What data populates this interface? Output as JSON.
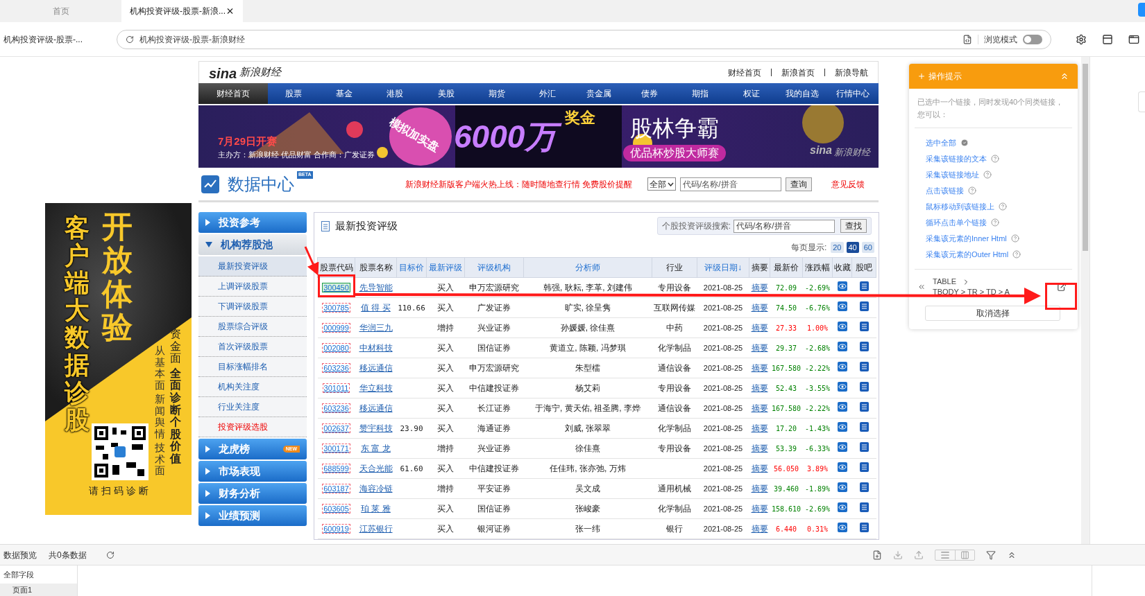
{
  "browser": {
    "tabs": [
      {
        "label": "首页",
        "selected": false
      },
      {
        "label": "机构投资评级-股票-新浪...",
        "selected": true
      }
    ],
    "page_title": "机构投资评级-股票-...",
    "address": "机构投资评级-股票-新浪财经",
    "browse_mode": {
      "label": "浏览模式",
      "on": false
    }
  },
  "site": {
    "logo_mark": "sina",
    "logo": "新浪财经",
    "top_links": [
      "财经首页",
      "新浪首页",
      "新浪导航"
    ],
    "nav": [
      {
        "label": "财经首页",
        "selected": true
      },
      {
        "label": "股票",
        "selected": false
      },
      {
        "label": "基金",
        "selected": false
      },
      {
        "label": "港股",
        "selected": false
      },
      {
        "label": "美股",
        "selected": false
      },
      {
        "label": "期货",
        "selected": false
      },
      {
        "label": "外汇",
        "selected": false
      },
      {
        "label": "贵金属",
        "selected": false
      },
      {
        "label": "债券",
        "selected": false
      },
      {
        "label": "期指",
        "selected": false
      },
      {
        "label": "权证",
        "selected": false
      },
      {
        "label": "我的自选",
        "selected": false
      },
      {
        "label": "行情中心",
        "selected": false
      }
    ],
    "banner": {
      "date": "7月29日开赛",
      "sponsors": "主办方：新浪财经 优品财富 合作商：广发证券",
      "tag": "模拟加实盘",
      "amount": "6000万",
      "prize": "奖金",
      "headline": "股林争霸",
      "subtitle": "优品杯炒股大师赛",
      "brand_mark": "sina",
      "brand": "新浪财经"
    },
    "data_center": {
      "title": "数据中心",
      "badge": "BETA",
      "promo": "新浪财经新版客户端火热上线：随时随地查行情 免费股价提醒",
      "scope": "全部",
      "search_placeholder": "代码/名称/拼音",
      "search_button": "查询",
      "feedback": "意见反馈"
    }
  },
  "ad": {
    "headline": "开放体验",
    "title": "客户端大数据诊股",
    "line_1": "资金面",
    "line_2": "全面诊断个股价值",
    "line_3": [
      "从基本面",
      "新闻舆情",
      "技术面"
    ],
    "caption": "请扫码诊断"
  },
  "sidebar": {
    "sections": [
      {
        "label": "投资参考",
        "expanded": false
      },
      {
        "label": "机构荐股池",
        "expanded": true,
        "items": [
          {
            "label": "最新投资评级",
            "selected": true,
            "emphasized": false
          },
          {
            "label": "上调评级股票",
            "selected": false,
            "emphasized": false
          },
          {
            "label": "下调评级股票",
            "selected": false,
            "emphasized": false
          },
          {
            "label": "股票综合评级",
            "selected": false,
            "emphasized": false
          },
          {
            "label": "首次评级股票",
            "selected": false,
            "emphasized": false
          },
          {
            "label": "目标涨幅排名",
            "selected": false,
            "emphasized": false
          },
          {
            "label": "机构关注度",
            "selected": false,
            "emphasized": false
          },
          {
            "label": "行业关注度",
            "selected": false,
            "emphasized": false
          },
          {
            "label": "投资评级选股",
            "selected": false,
            "emphasized": true
          }
        ]
      },
      {
        "label": "龙虎榜",
        "expanded": false,
        "badge": "NEW"
      },
      {
        "label": "市场表现",
        "expanded": false
      },
      {
        "label": "财务分析",
        "expanded": false
      },
      {
        "label": "业绩预测",
        "expanded": false
      }
    ]
  },
  "ratings": {
    "title": "最新投资评级",
    "search_label": "个股投资评级搜索:",
    "search_placeholder": "代码/名称/拼音",
    "search_button": "查找",
    "page_size_label": "每页显示:",
    "page_sizes": [
      {
        "label": "20",
        "selected": false
      },
      {
        "label": "40",
        "selected": true
      },
      {
        "label": "60",
        "selected": false
      }
    ],
    "columns": [
      {
        "label": "股票代码",
        "link": false
      },
      {
        "label": "股票名称",
        "link": false
      },
      {
        "label": "目标价",
        "link": true
      },
      {
        "label": "最新评级",
        "link": true
      },
      {
        "label": "评级机构",
        "link": true
      },
      {
        "label": "分析师",
        "link": true
      },
      {
        "label": "行业",
        "link": false
      },
      {
        "label": "评级日期↓",
        "link": true
      },
      {
        "label": "摘要",
        "link": false
      },
      {
        "label": "最新价",
        "link": false
      },
      {
        "label": "涨跌幅",
        "link": false
      },
      {
        "label": "收藏",
        "link": false
      },
      {
        "label": "股吧",
        "link": false
      }
    ],
    "rows": [
      {
        "code": "300450",
        "selected": true,
        "name": "先导智能",
        "rating": "买入",
        "org": "申万宏源研究",
        "analyst": "韩强, 耿耘, 李革, 刘建伟",
        "industry": "专用设备",
        "date": "2021-08-25",
        "summary": "摘要",
        "price": "72.09",
        "change": "-2.69%",
        "color": "#008000"
      },
      {
        "code": "300785",
        "selected": false,
        "name": "值 得 买",
        "target": "110.66",
        "rating": "买入",
        "org": "广发证券",
        "analyst": "旷实, 徐呈隽",
        "industry": "互联网传媒",
        "date": "2021-08-25",
        "summary": "摘要",
        "price": "74.50",
        "change": "-6.76%",
        "color": "#008000"
      },
      {
        "code": "000999",
        "selected": false,
        "name": "华润三九",
        "rating": "增持",
        "org": "兴业证券",
        "analyst": "孙媛媛, 徐佳熹",
        "industry": "中药",
        "date": "2021-08-25",
        "summary": "摘要",
        "price": "27.33",
        "change": "1.00%",
        "color": "#ff0000"
      },
      {
        "code": "002080",
        "selected": false,
        "name": "中材科技",
        "rating": "买入",
        "org": "国信证券",
        "analyst": "黄道立, 陈颖, 冯梦琪",
        "industry": "化学制品",
        "date": "2021-08-25",
        "summary": "摘要",
        "price": "29.37",
        "change": "-2.68%",
        "color": "#008000"
      },
      {
        "code": "603236",
        "selected": false,
        "name": "移远通信",
        "rating": "买入",
        "org": "申万宏源研究",
        "analyst": "朱型檑",
        "industry": "通信设备",
        "date": "2021-08-25",
        "summary": "摘要",
        "price": "167.580",
        "change": "-2.22%",
        "color": "#008000"
      },
      {
        "code": "301011",
        "selected": false,
        "name": "华立科技",
        "rating": "买入",
        "org": "中信建投证券",
        "analyst": "杨艾莉",
        "industry": "专用设备",
        "date": "2021-08-25",
        "summary": "摘要",
        "price": "52.43",
        "change": "-3.55%",
        "color": "#008000"
      },
      {
        "code": "603236",
        "selected": false,
        "name": "移远通信",
        "rating": "买入",
        "org": "长江证券",
        "analyst": "于海宁, 黄天佑, 祖圣腾, 李烨",
        "industry": "通信设备",
        "date": "2021-08-25",
        "summary": "摘要",
        "price": "167.580",
        "change": "-2.22%",
        "color": "#008000"
      },
      {
        "code": "002637",
        "selected": false,
        "name": "赞宇科技",
        "target": "23.90",
        "rating": "买入",
        "org": "海通证券",
        "analyst": "刘威, 张翠翠",
        "industry": "化学制品",
        "date": "2021-08-25",
        "summary": "摘要",
        "price": "17.20",
        "change": "-1.43%",
        "color": "#008000"
      },
      {
        "code": "300171",
        "selected": false,
        "name": "东 富 龙",
        "rating": "增持",
        "org": "兴业证券",
        "analyst": "徐佳熹",
        "industry": "专用设备",
        "date": "2021-08-25",
        "summary": "摘要",
        "price": "53.39",
        "change": "-6.33%",
        "color": "#008000"
      },
      {
        "code": "688599",
        "selected": false,
        "name": "天合光能",
        "target": "61.60",
        "rating": "买入",
        "org": "中信建投证券",
        "analyst": "任佳玮, 张亦弛, 万炜",
        "date": "2021-08-25",
        "summary": "摘要",
        "price": "56.050",
        "change": "3.89%",
        "color": "#ff0000"
      },
      {
        "code": "603187",
        "selected": false,
        "name": "海容冷链",
        "rating": "增持",
        "org": "平安证券",
        "analyst": "吴文成",
        "industry": "通用机械",
        "date": "2021-08-25",
        "summary": "摘要",
        "price": "39.460",
        "change": "-1.89%",
        "color": "#008000"
      },
      {
        "code": "603605",
        "selected": false,
        "name": "珀 莱 雅",
        "rating": "买入",
        "org": "国信证券",
        "analyst": "张峻豪",
        "industry": "化学制品",
        "date": "2021-08-25",
        "summary": "摘要",
        "price": "158.610",
        "change": "-2.69%",
        "color": "#008000"
      },
      {
        "code": "600919",
        "selected": false,
        "name": "江苏银行",
        "rating": "买入",
        "org": "银河证券",
        "analyst": "张一纬",
        "industry": "银行",
        "date": "2021-08-25",
        "summary": "摘要",
        "price": "6.440",
        "change": "0.31%",
        "color": "#ff0000"
      }
    ]
  },
  "helper": {
    "title": "操作提示",
    "message": "已选中一个链接，同时发现40个同类链接，您可以：",
    "actions": [
      {
        "label": "选中全部",
        "kind": "check"
      },
      {
        "label": "采集该链接的文本",
        "kind": "help"
      },
      {
        "label": "采集该链接地址",
        "kind": "help"
      },
      {
        "label": "点击该链接",
        "kind": "help"
      },
      {
        "label": "鼠标移动到该链接上",
        "kind": "help"
      },
      {
        "label": "循环点击单个链接",
        "kind": "help"
      },
      {
        "label": "采集该元素的Inner Html",
        "kind": "help"
      },
      {
        "label": "采集该元素的Outer Html",
        "kind": "help"
      }
    ],
    "path": [
      "TABLE",
      "TBODY > TR > TD > A"
    ],
    "cancel": "取消选择"
  },
  "preview": {
    "title": "数据预览",
    "count": "共0条数据",
    "fields_label": "全部字段",
    "pages": [
      "页面1"
    ]
  }
}
